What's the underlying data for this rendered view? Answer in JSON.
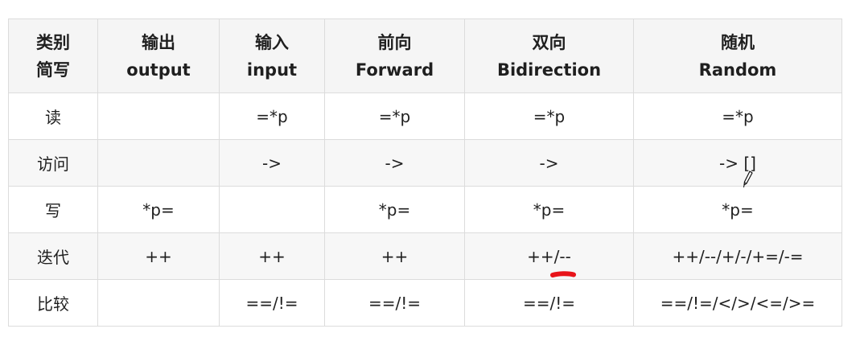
{
  "header": {
    "category": [
      "类别",
      "简写"
    ],
    "columns": [
      {
        "zh": "输出",
        "en": "output"
      },
      {
        "zh": "输入",
        "en": "input"
      },
      {
        "zh": "前向",
        "en": "Forward"
      },
      {
        "zh": "双向",
        "en": "Bidirection"
      },
      {
        "zh": "随机",
        "en": "Random"
      }
    ]
  },
  "rows": [
    {
      "label": "读",
      "cells": [
        "",
        "=*p",
        "=*p",
        "=*p",
        "=*p"
      ]
    },
    {
      "label": "访问",
      "cells": [
        "",
        "->",
        "->",
        "->",
        "-> []"
      ]
    },
    {
      "label": "写",
      "cells": [
        "*p=",
        "",
        "*p=",
        "*p=",
        "*p="
      ]
    },
    {
      "label": "迭代",
      "cells": [
        "++",
        "++",
        "++",
        "++/--",
        "++/--/+/-/+=/-="
      ]
    },
    {
      "label": "比较",
      "cells": [
        "",
        "==/!=",
        "==/!=",
        "==/!=",
        "==/!=/</>/<=/>="
      ]
    }
  ],
  "colors": {
    "header_bg": "#f5f5f5",
    "border": "#dcdcdc",
    "stripe_bg": "#f7f7f7",
    "annotation_red": "#e8141a"
  },
  "icons": {
    "cursor": "pen-cursor-icon"
  }
}
